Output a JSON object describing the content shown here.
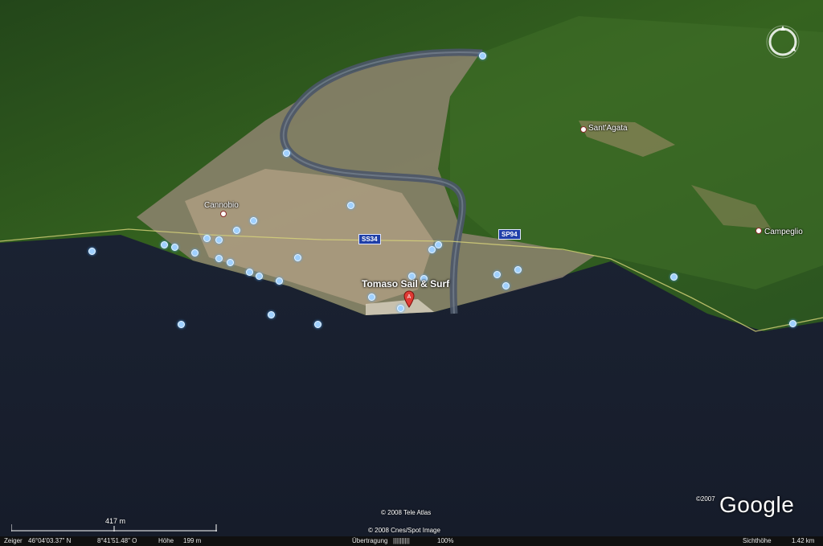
{
  "map": {
    "places": {
      "cannobio": "Cannobio",
      "sant_agata": "Sant'Agata",
      "campeglio": "Campeglio"
    },
    "roads": {
      "ss34": "SS34",
      "sp94": "SP94"
    },
    "placemark": {
      "title": "Tomaso Sail & Surf",
      "marker_letter": "A"
    },
    "credits": {
      "tele_atlas": "© 2008 Tele Atlas",
      "cnes": "© 2008 Cnes/Spot Image"
    },
    "logo": {
      "copyright": "©2007",
      "text": "Google"
    },
    "scale": {
      "label": "417 m"
    }
  },
  "status": {
    "pointer_label": "Zeiger",
    "lat": "46°04'03.37\" N",
    "lon": "8°41'51.48\" O",
    "height_label": "Höhe",
    "height_value": "199 m",
    "streaming_label": "Übertragung",
    "streaming_bar": "||||||||||",
    "streaming_value": "100%",
    "eye_label": "Sichthöhe",
    "eye_value": "1.42 km"
  },
  "colors": {
    "water": "#1b2232",
    "forest": "#2f5a22",
    "town": "#b7a487",
    "poi": "#9fd0ff",
    "shield": "#1f3fa8",
    "pin": "#e03a34"
  }
}
